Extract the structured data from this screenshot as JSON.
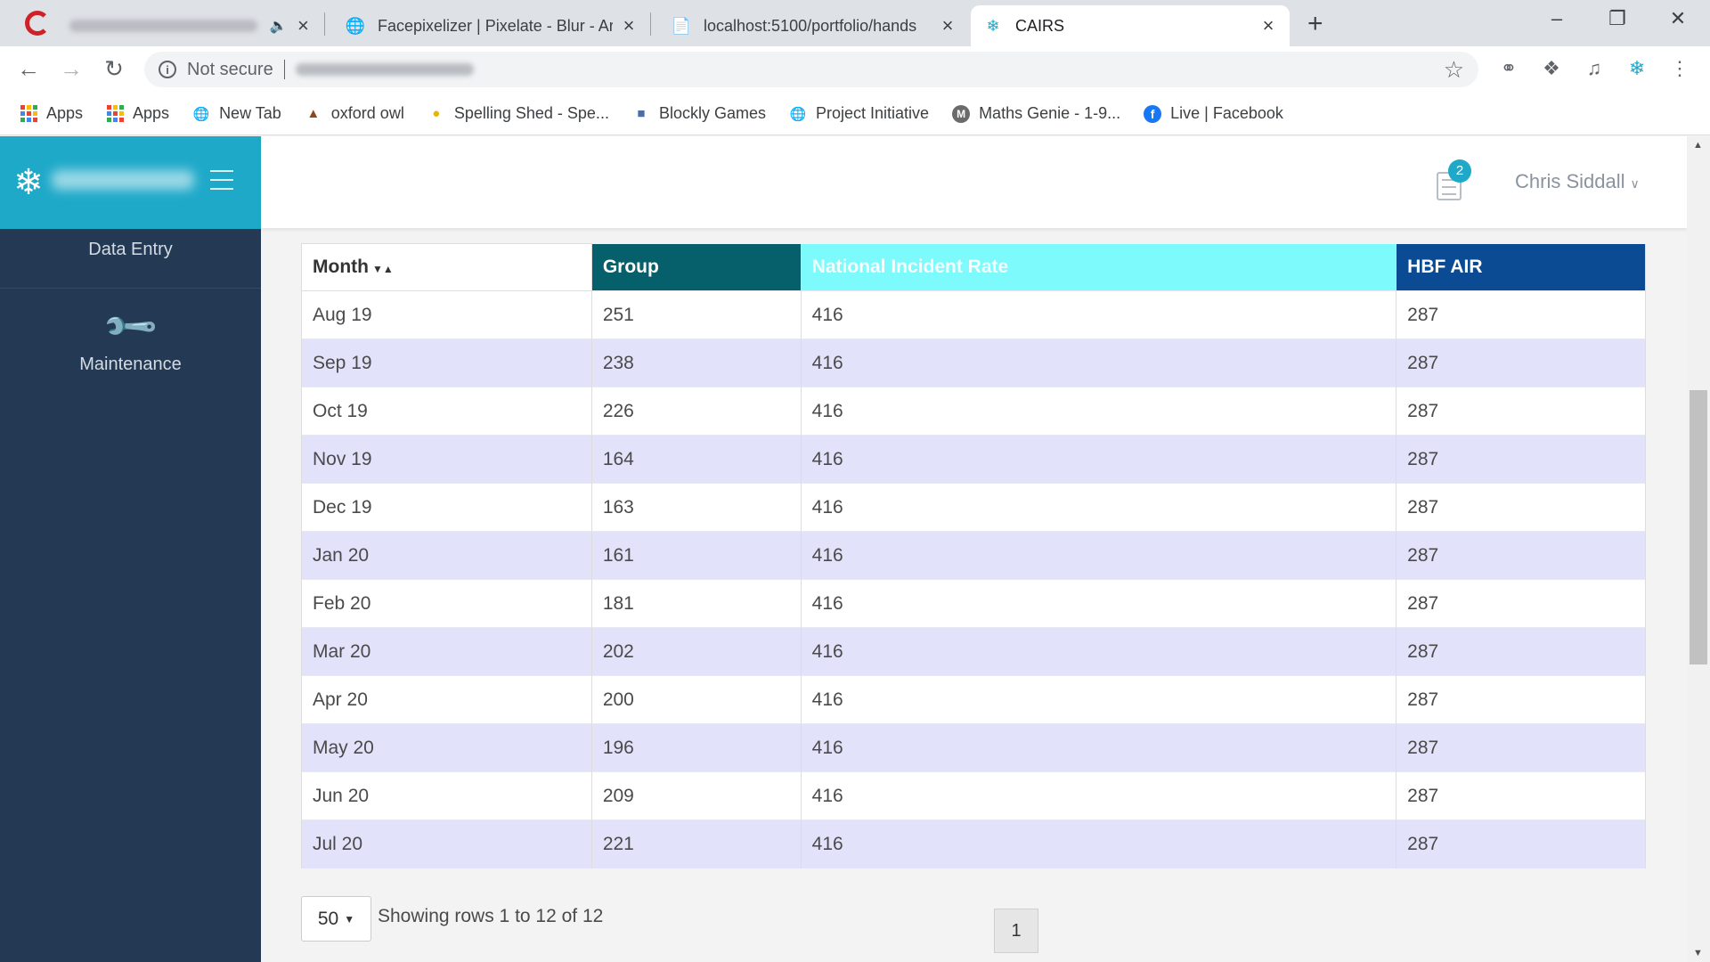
{
  "tabs": [
    {
      "title": "",
      "blurred": true,
      "muted": true
    },
    {
      "title": "Facepixelizer | Pixelate - Blur - Ar",
      "icon": "globe-icon"
    },
    {
      "title": "localhost:5100/portfolio/hands",
      "icon": "page-icon"
    },
    {
      "title": "CAIRS",
      "icon": "snowflake-icon",
      "active": true
    }
  ],
  "toolbar": {
    "security": "Not secure"
  },
  "bookmarks": [
    {
      "label": "Apps",
      "icon": "apps-grid-icon"
    },
    {
      "label": "Apps",
      "icon": "apps-grid-icon"
    },
    {
      "label": "New Tab",
      "icon": "globe-icon"
    },
    {
      "label": "oxford owl",
      "icon": "owl-icon"
    },
    {
      "label": "Spelling Shed - Spe...",
      "icon": "bee-icon"
    },
    {
      "label": "Blockly Games",
      "icon": "blockly-icon"
    },
    {
      "label": "Project Initiative",
      "icon": "globe-icon"
    },
    {
      "label": "Maths Genie - 1-9...",
      "icon": "maths-genie-icon"
    },
    {
      "label": "Live | Facebook",
      "icon": "facebook-icon"
    }
  ],
  "sidebar": {
    "items": [
      {
        "label": "Data Entry"
      },
      {
        "label": "Maintenance",
        "icon": "wrench-icon"
      }
    ]
  },
  "header": {
    "notification_count": "2",
    "user_name": "Chris Siddall"
  },
  "table": {
    "columns": [
      "Month",
      "Group",
      "National Incident Rate",
      "HBF AIR"
    ],
    "column_colors": [
      "#ffffff",
      "#05606b",
      "#7cfafc",
      "#0a4b93"
    ],
    "rows": [
      [
        "Aug 19",
        "251",
        "416",
        "287"
      ],
      [
        "Sep 19",
        "238",
        "416",
        "287"
      ],
      [
        "Oct 19",
        "226",
        "416",
        "287"
      ],
      [
        "Nov 19",
        "164",
        "416",
        "287"
      ],
      [
        "Dec 19",
        "163",
        "416",
        "287"
      ],
      [
        "Jan 20",
        "161",
        "416",
        "287"
      ],
      [
        "Feb 20",
        "181",
        "416",
        "287"
      ],
      [
        "Mar 20",
        "202",
        "416",
        "287"
      ],
      [
        "Apr 20",
        "200",
        "416",
        "287"
      ],
      [
        "May 20",
        "196",
        "416",
        "287"
      ],
      [
        "Jun 20",
        "209",
        "416",
        "287"
      ],
      [
        "Jul 20",
        "221",
        "416",
        "287"
      ]
    ]
  },
  "pagination": {
    "page_size": "50",
    "info": "Showing rows 1 to 12 of 12",
    "current_page": "1"
  },
  "colors": {
    "sidebar": "#243a54",
    "brand": "#1fa9c9",
    "row_alt": "#e2e2fb"
  }
}
